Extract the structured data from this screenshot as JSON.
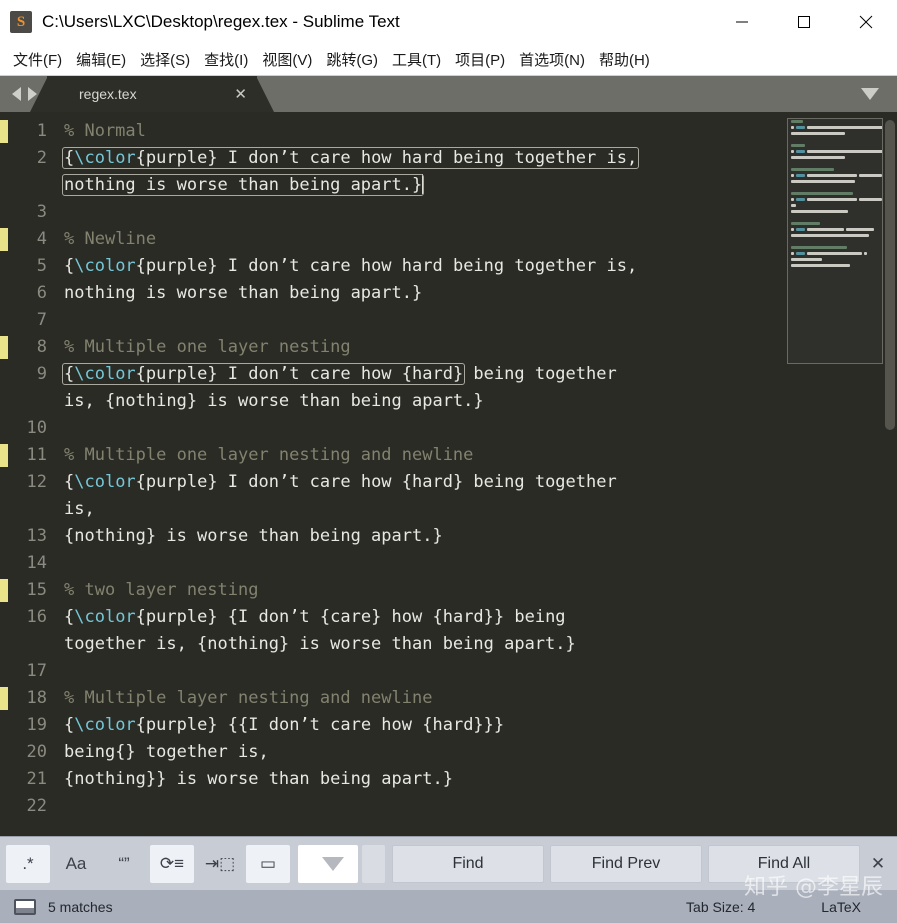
{
  "window": {
    "title": "C:\\Users\\LXC\\Desktop\\regex.tex - Sublime Text",
    "logo_glyph": "S",
    "minimize": "—",
    "maximize": "□",
    "close": "✕"
  },
  "menubar": {
    "items": [
      {
        "label": "文件(F)",
        "name": "menu-file"
      },
      {
        "label": "编辑(E)",
        "name": "menu-edit"
      },
      {
        "label": "选择(S)",
        "name": "menu-selection"
      },
      {
        "label": "查找(I)",
        "name": "menu-find"
      },
      {
        "label": "视图(V)",
        "name": "menu-view"
      },
      {
        "label": "跳转(G)",
        "name": "menu-goto"
      },
      {
        "label": "工具(T)",
        "name": "menu-tools"
      },
      {
        "label": "项目(P)",
        "name": "menu-project"
      },
      {
        "label": "首选项(N)",
        "name": "menu-preferences"
      },
      {
        "label": "帮助(H)",
        "name": "menu-help"
      }
    ]
  },
  "tabs": {
    "active_label": "regex.tex",
    "close_glyph": "✕"
  },
  "editor": {
    "language": "LaTeX",
    "lines": [
      {
        "no": "1",
        "marked": true,
        "segments": [
          {
            "t": "% Normal",
            "c": "cmt"
          }
        ]
      },
      {
        "no": "2",
        "marked": false,
        "boxed": true,
        "segments": [
          {
            "t": "{",
            "c": ""
          },
          {
            "t": "\\color",
            "c": "cyan"
          },
          {
            "t": "{purple} I don’t care how hard being together is,",
            "c": ""
          }
        ]
      },
      {
        "no": "",
        "marked": false,
        "wrapped": true,
        "boxed": true,
        "caret": true,
        "segments": [
          {
            "t": "nothing is worse than being apart.}",
            "c": ""
          }
        ]
      },
      {
        "no": "3",
        "marked": false,
        "segments": []
      },
      {
        "no": "4",
        "marked": true,
        "segments": [
          {
            "t": "% Newline",
            "c": "cmt"
          }
        ]
      },
      {
        "no": "5",
        "marked": false,
        "segments": [
          {
            "t": "{",
            "c": ""
          },
          {
            "t": "\\color",
            "c": "cyan"
          },
          {
            "t": "{purple} I don’t care how hard being together is,",
            "c": ""
          }
        ]
      },
      {
        "no": "6",
        "marked": false,
        "segments": [
          {
            "t": "nothing is worse than being apart.}",
            "c": ""
          }
        ]
      },
      {
        "no": "7",
        "marked": false,
        "segments": []
      },
      {
        "no": "8",
        "marked": true,
        "segments": [
          {
            "t": "% Multiple one layer nesting",
            "c": "cmt"
          }
        ]
      },
      {
        "no": "9",
        "marked": false,
        "boxed_partial": "{\\color{purple} I don’t care how {hard}",
        "segments": [
          {
            "t": "{",
            "c": ""
          },
          {
            "t": "\\color",
            "c": "cyan"
          },
          {
            "t": "{purple} I don’t care how {hard}",
            "c": ""
          },
          {
            "t": " being together",
            "c": "",
            "outside": true
          }
        ]
      },
      {
        "no": "",
        "marked": false,
        "wrapped": true,
        "segments": [
          {
            "t": "is, {nothing} is worse than being apart.}",
            "c": ""
          }
        ]
      },
      {
        "no": "10",
        "marked": false,
        "segments": []
      },
      {
        "no": "11",
        "marked": true,
        "segments": [
          {
            "t": "% Multiple one layer nesting and newline",
            "c": "cmt"
          }
        ]
      },
      {
        "no": "12",
        "marked": false,
        "segments": [
          {
            "t": "{",
            "c": ""
          },
          {
            "t": "\\color",
            "c": "cyan"
          },
          {
            "t": "{purple} I don’t care how {hard}",
            "c": ""
          },
          {
            "t": " being together",
            "c": "",
            "outside": true
          }
        ]
      },
      {
        "no": "",
        "marked": false,
        "wrapped": true,
        "segments": [
          {
            "t": "is,",
            "c": ""
          }
        ]
      },
      {
        "no": "13",
        "marked": false,
        "segments": [
          {
            "t": "{nothing} is worse than being apart.}",
            "c": ""
          }
        ]
      },
      {
        "no": "14",
        "marked": false,
        "segments": []
      },
      {
        "no": "15",
        "marked": true,
        "segments": [
          {
            "t": "% two layer nesting",
            "c": "cmt"
          }
        ]
      },
      {
        "no": "16",
        "marked": false,
        "segments": [
          {
            "t": "{",
            "c": ""
          },
          {
            "t": "\\color",
            "c": "cyan"
          },
          {
            "t": "{purple} {I don’t {care}",
            "c": ""
          },
          {
            "t": " how {hard}} being",
            "c": "",
            "outside": true
          }
        ]
      },
      {
        "no": "",
        "marked": false,
        "wrapped": true,
        "segments": [
          {
            "t": "together is, {nothing} is worse than being apart.}",
            "c": ""
          }
        ]
      },
      {
        "no": "17",
        "marked": false,
        "segments": []
      },
      {
        "no": "18",
        "marked": true,
        "segments": [
          {
            "t": "% Multiple layer nesting and newline",
            "c": "cmt"
          }
        ]
      },
      {
        "no": "19",
        "marked": false,
        "segments": [
          {
            "t": "{",
            "c": ""
          },
          {
            "t": "\\color",
            "c": "cyan"
          },
          {
            "t": "{purple} {{I don’t care how {hard}}",
            "c": ""
          },
          {
            "t": "}",
            "c": "",
            "outside": true
          }
        ]
      },
      {
        "no": "20",
        "marked": false,
        "segments": [
          {
            "t": "being{} together is,",
            "c": ""
          }
        ]
      },
      {
        "no": "21",
        "marked": false,
        "segments": [
          {
            "t": "{nothing}} is worse than being apart.}",
            "c": ""
          }
        ]
      },
      {
        "no": "22",
        "marked": false,
        "segments": []
      }
    ]
  },
  "findbar": {
    "toggles": [
      {
        "name": "regex-toggle",
        "glyph": ".*",
        "active": true,
        "title": "regex"
      },
      {
        "name": "case-sensitive-toggle",
        "glyph": "Aa",
        "active": false,
        "title": "case sensitive"
      },
      {
        "name": "whole-word-toggle",
        "glyph": "“”",
        "active": false,
        "title": "whole word"
      },
      {
        "name": "wrap-toggle",
        "glyph": "⟳≡",
        "active": true,
        "title": "wrap"
      },
      {
        "name": "in-selection-toggle",
        "glyph": "⇥⬚",
        "active": false,
        "title": "in selection"
      },
      {
        "name": "highlight-results-toggle",
        "glyph": "▭",
        "active": true,
        "title": "highlight results"
      }
    ],
    "find_value": "",
    "find_placeholder": "",
    "buttons": [
      {
        "label": "Find",
        "name": "find-button"
      },
      {
        "label": "Find Prev",
        "name": "find-prev-button"
      },
      {
        "label": "Find All",
        "name": "find-all-button"
      }
    ],
    "close_glyph": "✕"
  },
  "statusbar": {
    "matches": "5 matches",
    "tab_size": "Tab Size: 4",
    "syntax": "LaTeX"
  },
  "watermark": "知乎 @李星辰",
  "colors": {
    "editor_bg": "#2b2b26",
    "comment": "#82826f",
    "keyword_cyan": "#74c7d6",
    "text": "#e8e8e2",
    "gutter_mark": "#e9e48a",
    "tabbar_bg": "#6e6e68",
    "findbar_bg": "#c8ccd4",
    "statusbar_bg": "#a9afbb"
  }
}
